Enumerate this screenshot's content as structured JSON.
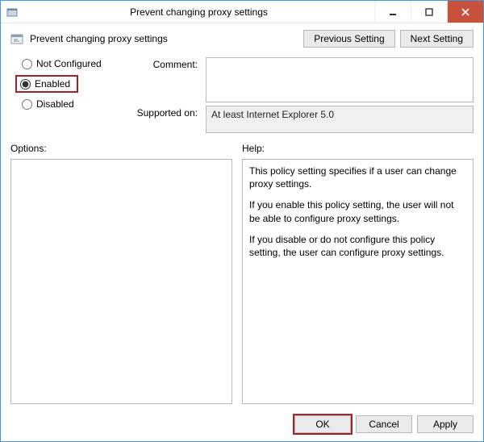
{
  "titlebar": {
    "title": "Prevent changing proxy settings"
  },
  "header": {
    "setting_title": "Prevent changing proxy settings",
    "previous_label": "Previous Setting",
    "next_label": "Next Setting"
  },
  "state": {
    "not_configured_label": "Not Configured",
    "enabled_label": "Enabled",
    "disabled_label": "Disabled",
    "selected": "enabled"
  },
  "labels": {
    "comment": "Comment:",
    "supported_on": "Supported on:",
    "options": "Options:",
    "help": "Help:"
  },
  "comment_value": "",
  "supported_on_value": "At least Internet Explorer 5.0",
  "help": {
    "p1": "This policy setting specifies if a user can change proxy settings.",
    "p2": "If you enable this policy setting, the user will not be able to configure proxy settings.",
    "p3": "If you disable or do not configure this policy setting, the user can configure proxy settings."
  },
  "buttons": {
    "ok": "OK",
    "cancel": "Cancel",
    "apply": "Apply"
  },
  "highlight_color": "#a4202a"
}
